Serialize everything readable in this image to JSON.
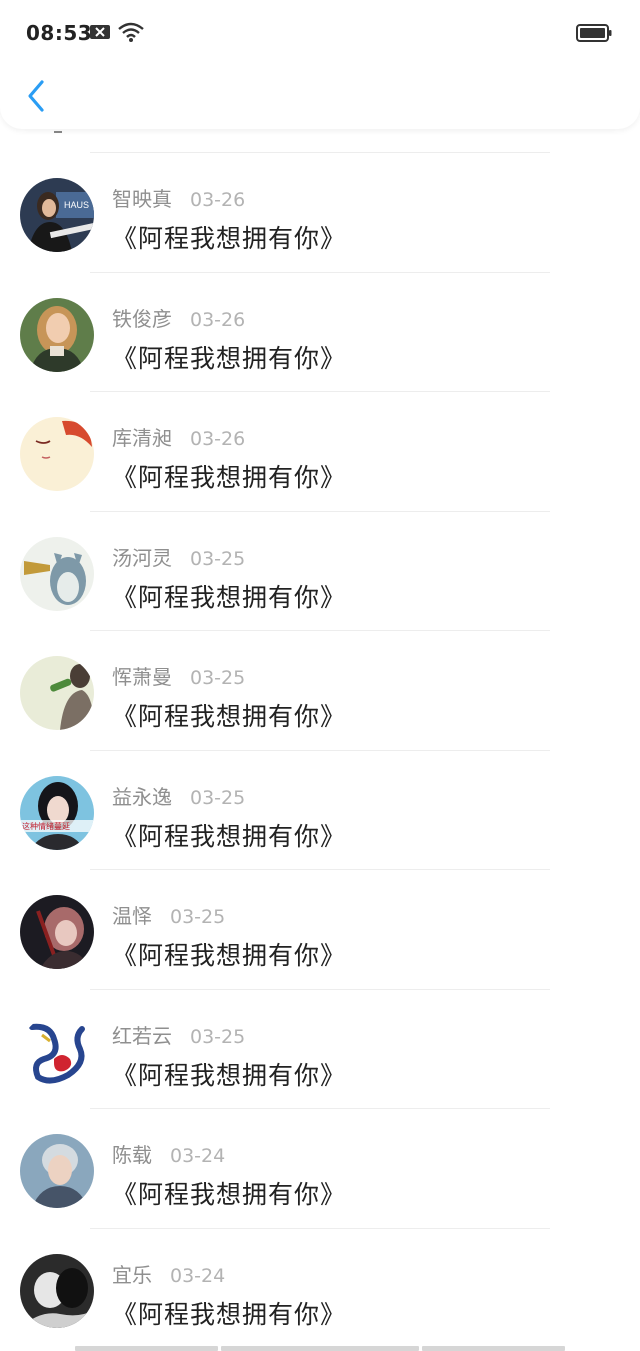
{
  "status_bar": {
    "time": "08:53",
    "icons": [
      "notification-close-icon",
      "wifi-icon",
      "battery-icon"
    ]
  },
  "header": {
    "back_icon": "chevron-left-icon",
    "accent_color": "#2a9df4"
  },
  "messages": [
    {
      "name": "智映真",
      "date": "03-26",
      "text": "《阿程我想拥有你》"
    },
    {
      "name": "铁俊彦",
      "date": "03-26",
      "text": "《阿程我想拥有你》"
    },
    {
      "name": "库清昶",
      "date": "03-26",
      "text": "《阿程我想拥有你》"
    },
    {
      "name": "汤河灵",
      "date": "03-25",
      "text": "《阿程我想拥有你》"
    },
    {
      "name": "恽萧曼",
      "date": "03-25",
      "text": "《阿程我想拥有你》"
    },
    {
      "name": "益永逸",
      "date": "03-25",
      "text": "《阿程我想拥有你》"
    },
    {
      "name": "温怿",
      "date": "03-25",
      "text": "《阿程我想拥有你》"
    },
    {
      "name": "红若云",
      "date": "03-25",
      "text": "《阿程我想拥有你》"
    },
    {
      "name": "陈载",
      "date": "03-24",
      "text": "《阿程我想拥有你》"
    },
    {
      "name": "宜乐",
      "date": "03-24",
      "text": "《阿程我想拥有你》"
    }
  ],
  "avatar_text": {
    "haus": "HAUS",
    "caption": "这种情绪蔓延"
  }
}
